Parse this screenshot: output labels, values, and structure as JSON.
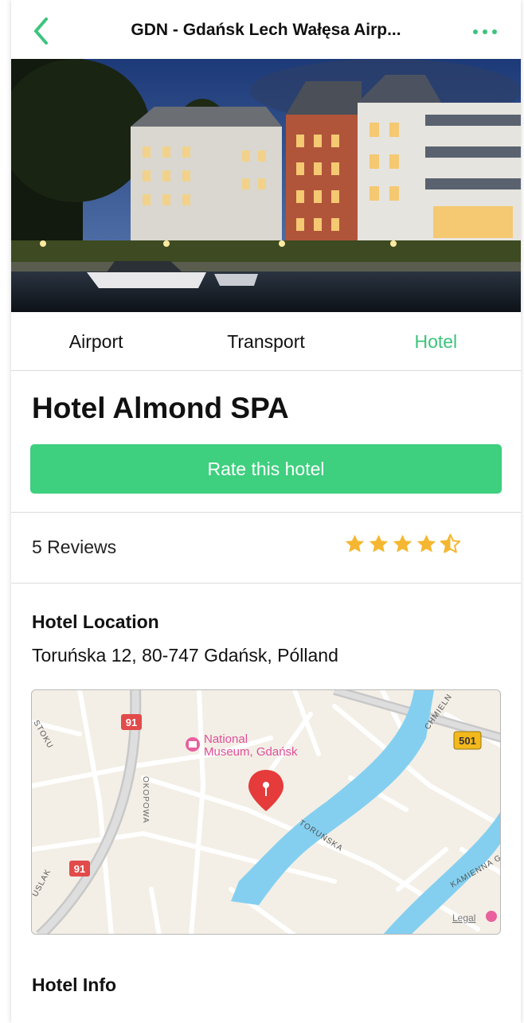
{
  "nav": {
    "title": "GDN - Gdańsk Lech Wałęsa Airp...",
    "back_icon": "chevron-left-icon",
    "more_icon": "ellipsis-icon"
  },
  "hero": {
    "image_alt": "Hotel exterior at night by waterfront"
  },
  "tabs": [
    {
      "label": "Airport",
      "active": false
    },
    {
      "label": "Transport",
      "active": false
    },
    {
      "label": "Hotel",
      "active": true
    }
  ],
  "hotel": {
    "name": "Hotel Almond SPA",
    "rate_button": "Rate this hotel",
    "reviews": "5 Reviews",
    "rating": 4.5,
    "location_title": "Hotel Location",
    "address": "Toruńska 12, 80-747 Gdańsk, Pólland",
    "info_title": "Hotel Info"
  },
  "map": {
    "labels": {
      "route_91_top": "91",
      "route_91_bottom": "91",
      "route_501": "501",
      "museum_line1": "National",
      "museum_line2": "Museum, Gdańsk",
      "street_okopowa": "OKOPOWA",
      "street_torunska": "TORUŃSKA",
      "street_stoku": "STOKU",
      "street_chmieln": "CHMIELN",
      "street_kamienna": "KAMIENNA GR",
      "street_uslak": "USLAK",
      "legal": "Legal"
    }
  },
  "colors": {
    "accent": "#3cc47c",
    "button": "#3ecf7f",
    "star": "#f5b731",
    "water": "#84cff0",
    "pin": "#e53b3b"
  }
}
